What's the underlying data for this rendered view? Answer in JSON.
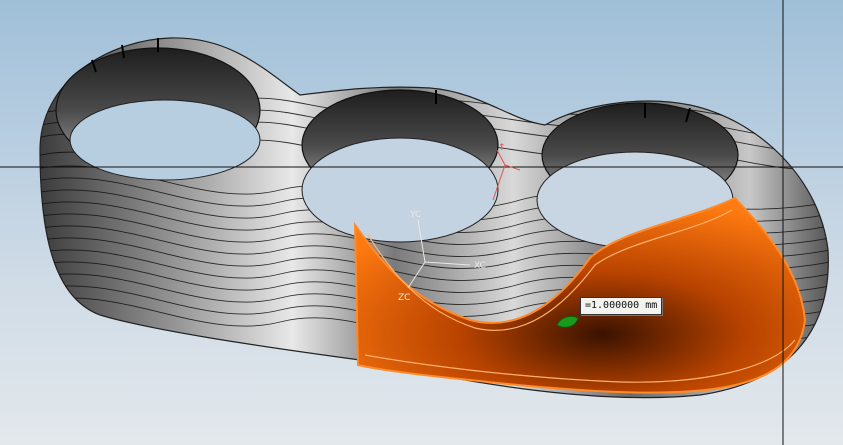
{
  "viewport": {
    "dimension_readout": "=1.000000 mm",
    "wcs_axes": {
      "x_label": "XC",
      "y_label": "YC",
      "z_label": "ZC"
    }
  },
  "colors": {
    "background_top": "#9fbfd8",
    "background_bottom": "#e3e8ec",
    "part_gray_light": "#e6e6e6",
    "part_gray_dark": "#3a3a3a",
    "selected_face": "#ff6a00",
    "drag_handle": "#1a9a1a",
    "datum_marker": "#e05050"
  },
  "icons": {
    "drag_handle": "drag-handle-icon",
    "datum_marker": "datum-csys-icon"
  }
}
